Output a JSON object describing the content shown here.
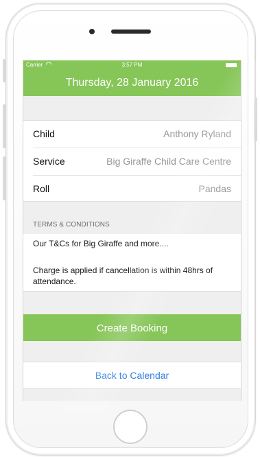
{
  "status_bar": {
    "carrier": "Carrier",
    "time": "3:57 PM",
    "wifi_icon": "wifi-icon",
    "battery_icon": "battery-icon"
  },
  "header": {
    "title": "Thursday, 28 January 2016"
  },
  "details": {
    "rows": [
      {
        "label": "Child",
        "value": "Anthony Ryland"
      },
      {
        "label": "Service",
        "value": "Big Giraffe Child Care Centre"
      },
      {
        "label": "Roll",
        "value": "Pandas"
      }
    ]
  },
  "terms": {
    "heading": "TERMS & CONDITIONS",
    "lines": [
      "Our T&Cs for Big Giraffe and more....",
      "Charge is applied if cancellation is within 48hrs of attendance."
    ]
  },
  "actions": {
    "create_booking": "Create Booking",
    "back_to_calendar": "Back to Calendar"
  },
  "colors": {
    "accent": "#86C557",
    "link": "#2F7FE0",
    "background": "#EFEFEF"
  }
}
